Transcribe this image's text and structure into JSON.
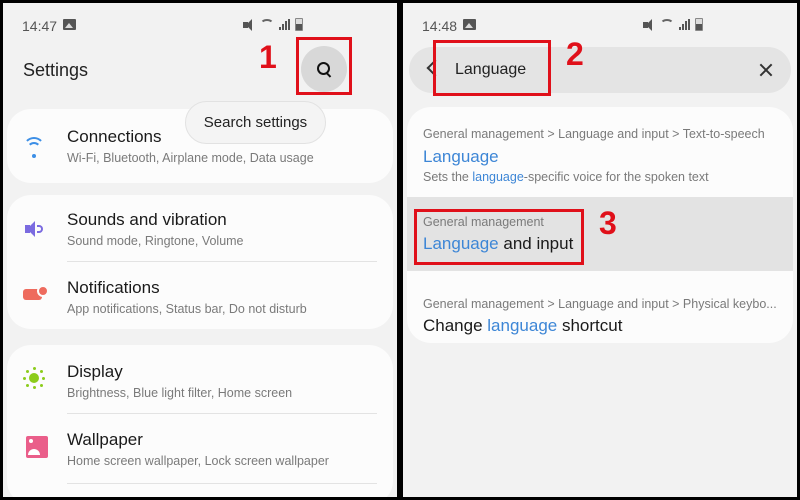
{
  "left_screen": {
    "status_bar": {
      "time": "14:47"
    },
    "header": {
      "title": "Settings"
    },
    "search_tooltip": "Search settings",
    "step_label": "1",
    "groups": [
      {
        "items": [
          {
            "icon": "wifi-icon",
            "title": "Connections",
            "subtitle": "Wi-Fi, Bluetooth, Airplane mode, Data usage",
            "icon_color": "#3d8fe6"
          }
        ]
      },
      {
        "items": [
          {
            "icon": "sound-icon",
            "title": "Sounds and vibration",
            "subtitle": "Sound mode, Ringtone, Volume",
            "icon_color": "#7b6be0"
          },
          {
            "icon": "notification-icon",
            "title": "Notifications",
            "subtitle": "App notifications, Status bar, Do not disturb",
            "icon_color": "#ee6b5e"
          }
        ]
      },
      {
        "items": [
          {
            "icon": "brightness-icon",
            "title": "Display",
            "subtitle": "Brightness, Blue light filter, Home screen",
            "icon_color": "#8ccc1c"
          },
          {
            "icon": "wallpaper-icon",
            "title": "Wallpaper",
            "subtitle": "Home screen wallpaper, Lock screen wallpaper",
            "icon_color": "#ea5e8a"
          }
        ]
      }
    ]
  },
  "right_screen": {
    "status_bar": {
      "time": "14:48"
    },
    "search": {
      "query": "Language"
    },
    "step_labels": [
      "2",
      "3"
    ],
    "results": [
      {
        "path": "General management > Language and input > Text-to-speech",
        "title_parts": [
          {
            "text": "Language",
            "highlight": true
          }
        ],
        "desc_parts": [
          {
            "text": "Sets the ",
            "highlight": false
          },
          {
            "text": "language",
            "highlight": true
          },
          {
            "text": "-specific voice for the spoken text",
            "highlight": false
          }
        ]
      },
      {
        "path": "General management",
        "title_parts": [
          {
            "text": "Language",
            "highlight": true
          },
          {
            "text": " and input",
            "highlight": false
          }
        ],
        "selected": true
      },
      {
        "path": "General management > Language and input > Physical keybo...",
        "title_parts": [
          {
            "text": "Change ",
            "highlight": false
          },
          {
            "text": "language",
            "highlight": true
          },
          {
            "text": " shortcut",
            "highlight": false
          }
        ]
      }
    ]
  },
  "colors": {
    "annotation_red": "#e0101a",
    "highlight_blue": "#3d86d6",
    "background": "#f2f2f2",
    "card": "#fcfcfc"
  }
}
